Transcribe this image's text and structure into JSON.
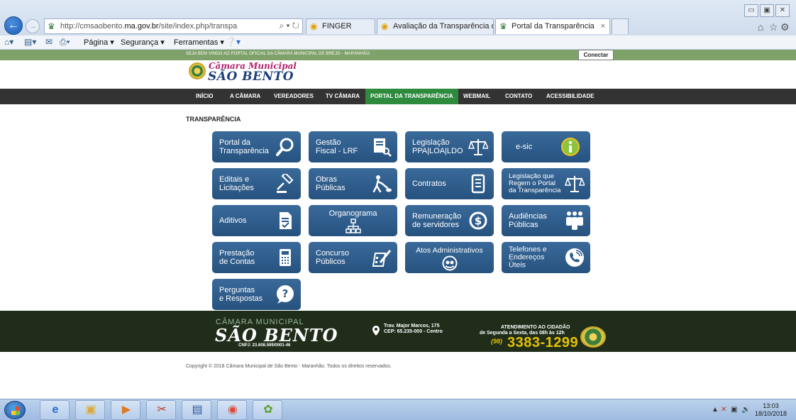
{
  "browser": {
    "url_scheme": "http://cmsaobento.",
    "url_domain": "ma.gov.br",
    "url_path": "/site/index.php/transpa",
    "addr_tools": "⌕ ▾ ↻",
    "tabs": [
      {
        "label": "FINGER"
      },
      {
        "label": "Avaliação da Transparência do..."
      },
      {
        "label": "Portal da Transparência",
        "close": "×"
      }
    ],
    "commands": {
      "page": "Página ▾",
      "security": "Segurança ▾",
      "tools": "Ferramentas ▾"
    },
    "window_controls": {
      "minimize": "▭",
      "restore": "▣",
      "close": "✕"
    }
  },
  "site": {
    "welcome": "SEJA BEM VINDO AO PORTAL OFICIAL DA CÂMARA MUNICIPAL DE BREJO - MARANHÃO.",
    "connect_label": "Conectar",
    "logo_top": "Câmara Municipal",
    "logo_main": "SÃO BENTO",
    "nav": [
      {
        "label": "INÍCIO"
      },
      {
        "label": "A CÂMARA"
      },
      {
        "label": "VEREADORES"
      },
      {
        "label": "TV CÂMARA"
      },
      {
        "label": "PORTAL DA TRANSPARÊNCIA"
      },
      {
        "label": "WEBMAIL"
      },
      {
        "label": "CONTATO"
      },
      {
        "label": "ACESSIBILIDADE"
      }
    ],
    "section_title": "TRANSPARÊNCIA",
    "tiles": [
      {
        "label": "Portal da\nTransparência",
        "icon": "magnifier-icon"
      },
      {
        "label": "Gestão\nFiscal - LRF",
        "icon": "report-search-icon"
      },
      {
        "label": "Legislação\nPPA|LOA|LDO",
        "icon": "scales-icon"
      },
      {
        "label": "e-sic",
        "icon": "info-icon"
      },
      {
        "label": "Editais e\nLicitações",
        "icon": "gavel-icon"
      },
      {
        "label": "Obras\nPúblicas",
        "icon": "worker-icon"
      },
      {
        "label": "Contratos",
        "icon": "document-icon"
      },
      {
        "label": "Legislação que\nRegem o Portal\nda Transparência",
        "icon": "scales-icon"
      },
      {
        "label": "Aditivos",
        "icon": "checklist-icon"
      },
      {
        "label": "Organograma",
        "icon": "org-chart-icon"
      },
      {
        "label": "Remuneração\nde servidores",
        "icon": "dollar-coin-icon"
      },
      {
        "label": "Audiências\nPúblicas",
        "icon": "people-icon"
      },
      {
        "label": "Prestação\nde Contas",
        "icon": "calculator-icon"
      },
      {
        "label": "Concurso\nPúblicos",
        "icon": "pen-form-icon"
      },
      {
        "label": "Atos Administrativos",
        "icon": "handshake-icon"
      },
      {
        "label": "Telefones e\nEndereços\nÚteis",
        "icon": "phone-icon"
      },
      {
        "label": "Perguntas\ne Respostas",
        "icon": "question-icon"
      }
    ],
    "footer": {
      "camara": "CÂMARA MUNICIPAL",
      "name": "SÃO BENTO",
      "cnpj": "CNPJ: 23.608.599/0001-46",
      "address": "Trav. Major Marcos, 175\nCEP: 65.235-000 - Centro",
      "attendance": "ATENDIMENTO AO CIDADÃO",
      "hours": "de Segunda a Sexta, das 08h às 12h",
      "ddd": "(98)",
      "phone": "3383-1299"
    },
    "copyright": "Copyright © 2018 Câmara Municipal de São Bento - Maranhão. Todos os direitos reservados."
  },
  "taskbar": {
    "time": "13:03",
    "date": "18/10/2018"
  },
  "colors": {
    "tile": "#2c5a89",
    "nav_bg": "#333333",
    "nav_active": "#2e8b3e",
    "greenbar": "#7fa16a",
    "footer_bg": "#1f2d1a",
    "phone": "#e6c200"
  }
}
